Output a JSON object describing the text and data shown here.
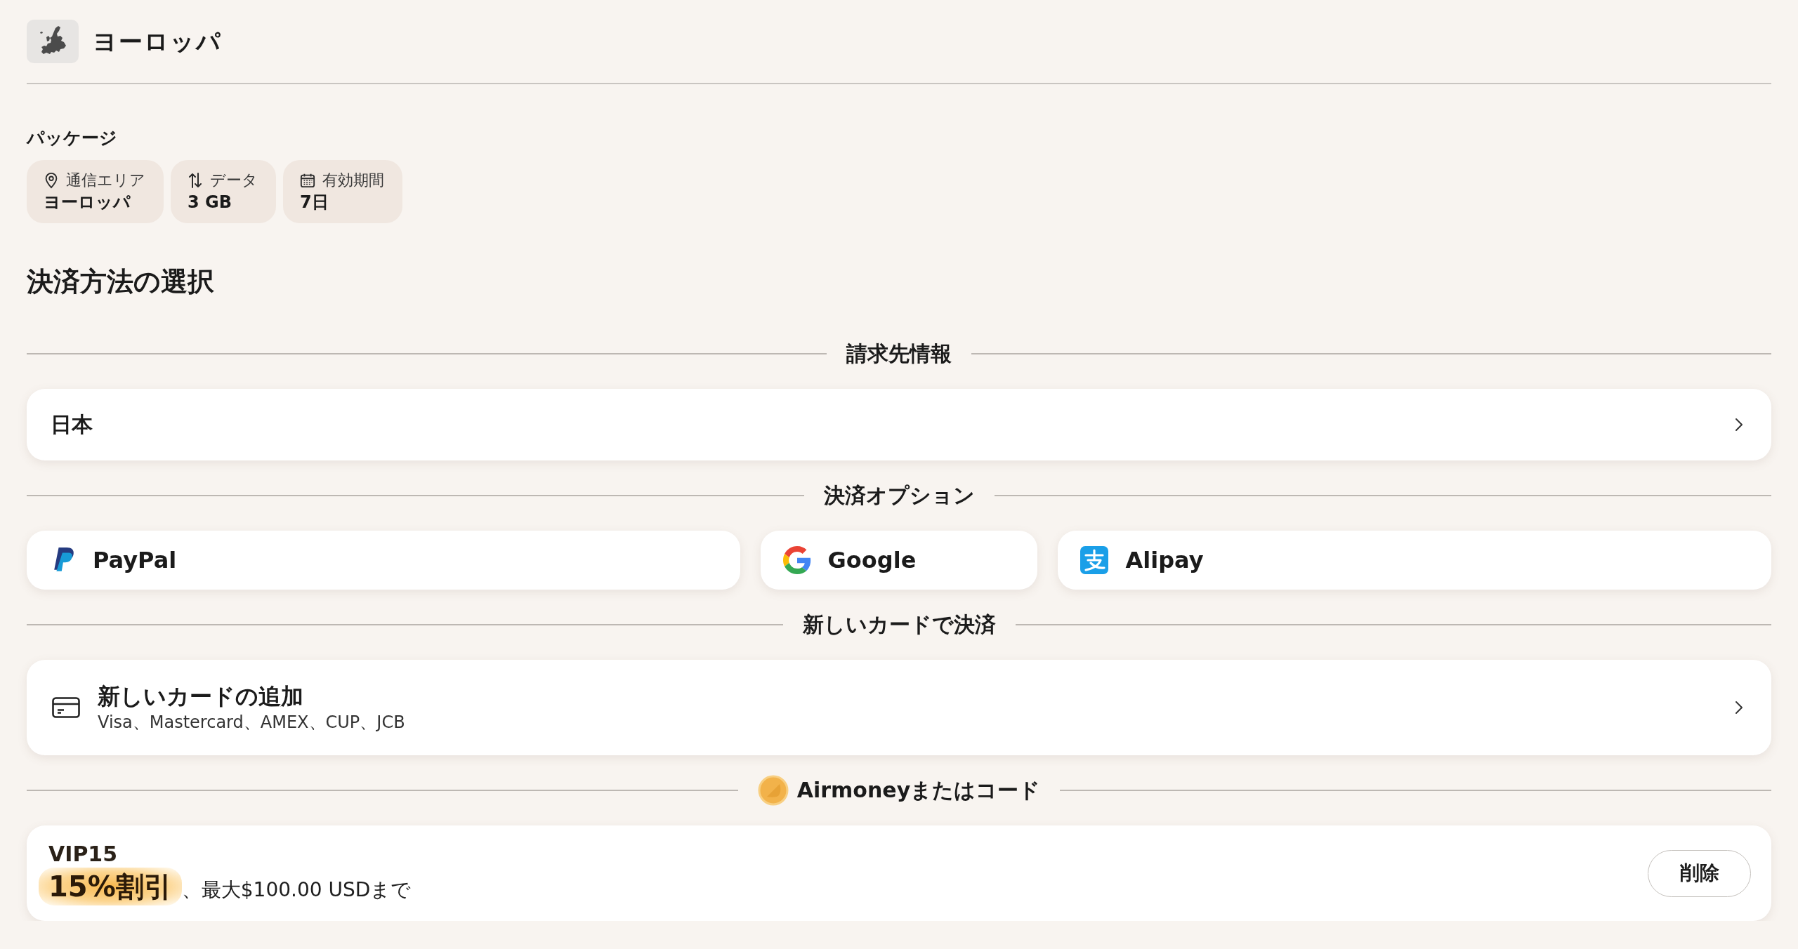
{
  "header": {
    "title": "ヨーロッパ"
  },
  "package": {
    "heading": "パッケージ",
    "chips": [
      {
        "kind": "area",
        "label": "通信エリア",
        "value": "ヨーロッパ"
      },
      {
        "kind": "data",
        "label": "データ",
        "value": "3 GB"
      },
      {
        "kind": "validity",
        "label": "有効期間",
        "value": "7日"
      }
    ]
  },
  "payment": {
    "title": "決済方法の選択",
    "sections": [
      {
        "kind": "billing",
        "heading": "請求先情報",
        "value": "日本"
      },
      {
        "kind": "options",
        "heading": "決済オプション",
        "options": [
          {
            "kind": "paypal",
            "label": "PayPal"
          },
          {
            "kind": "google",
            "label": "Google"
          },
          {
            "kind": "alipay",
            "label": "Alipay"
          }
        ]
      },
      {
        "kind": "card",
        "heading": "新しいカードで決済",
        "title": "新しいカードの追加",
        "subtitle": "Visa、Mastercard、AMEX、CUP、JCB"
      },
      {
        "kind": "promo",
        "heading": "Airmoneyまたはコード",
        "code": "VIP15",
        "discount": "15%割引",
        "limit": "、最大$100.00 USDまで",
        "button": "削除"
      }
    ]
  }
}
